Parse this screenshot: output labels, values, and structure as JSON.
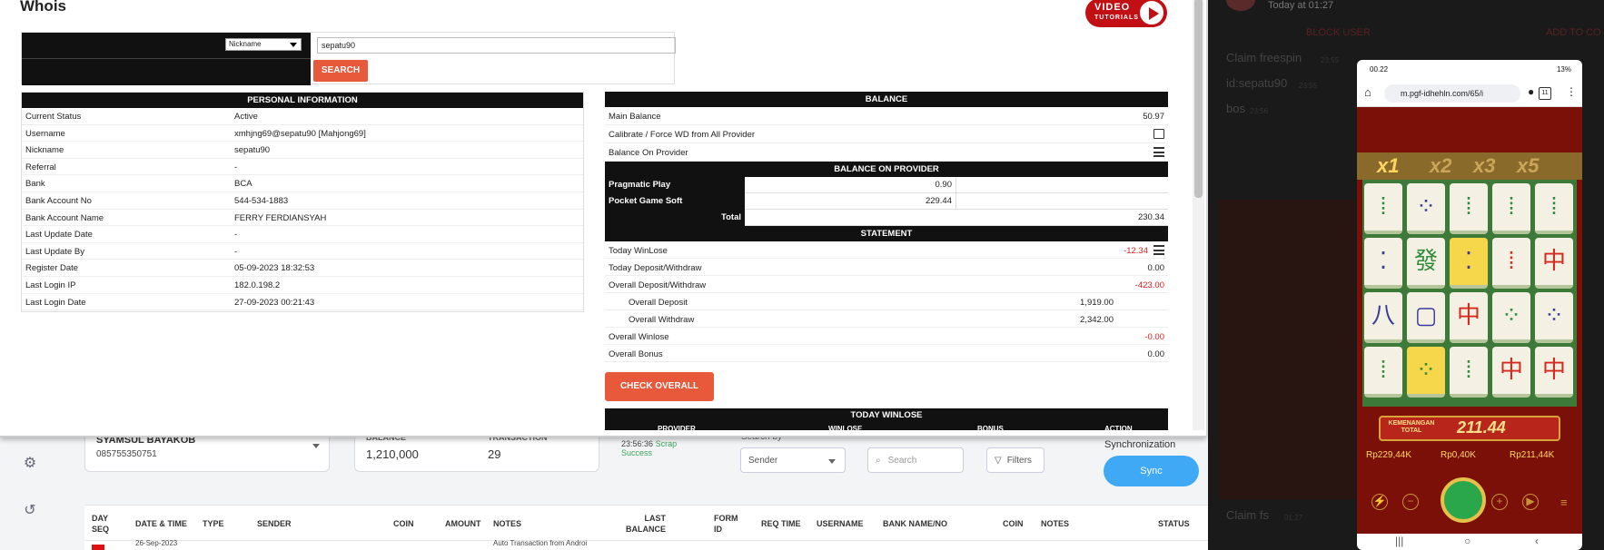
{
  "modal": {
    "title": "Whois",
    "video_line1": "VIDEO",
    "video_line2": "TUTORIALS"
  },
  "search": {
    "select_value": "Nickname",
    "input_value": "sepatu90",
    "button_label": "SEARCH"
  },
  "personal": {
    "header": "PERSONAL INFORMATION",
    "rows": [
      {
        "label": "Current Status",
        "value": "Active"
      },
      {
        "label": "Username",
        "value": "xmhjng69@sepatu90  [Mahjong69]"
      },
      {
        "label": "Nickname",
        "value": "sepatu90"
      },
      {
        "label": "Referral",
        "value": "-"
      },
      {
        "label": "Bank",
        "value": "BCA"
      },
      {
        "label": "Bank Account No",
        "value": "544-534-1883"
      },
      {
        "label": "Bank Account Name",
        "value": "FERRY FERDIANSYAH"
      },
      {
        "label": "Last Update Date",
        "value": "-"
      },
      {
        "label": "Last Update By",
        "value": "-"
      },
      {
        "label": "Register Date",
        "value": "05-09-2023 18:32:53"
      },
      {
        "label": "Last Login IP",
        "value": "182.0.198.2"
      },
      {
        "label": "Last Login Date",
        "value": "27-09-2023 00:21:43"
      }
    ]
  },
  "balance": {
    "header": "BALANCE",
    "main_label": "Main Balance",
    "main_value": "50.97",
    "calibrate_label": "Calibrate / Force WD from All Provider",
    "bop_label": "Balance On Provider",
    "provider_header": "BALANCE ON PROVIDER",
    "providers": [
      {
        "name": "Pragmatic Play",
        "value": "0.90"
      },
      {
        "name": "Pocket Game Soft",
        "value": "229.44"
      }
    ],
    "total_label": "Total",
    "total_value": "230.34"
  },
  "statement": {
    "header": "STATEMENT",
    "today_winlose_label": "Today WinLose",
    "today_winlose_value": "-12.34",
    "today_dw_label": "Today Deposit/Withdraw",
    "today_dw_value": "0.00",
    "overall_dw_label": "Overall Deposit/Withdraw",
    "overall_dw_value": "-423.00",
    "overall_deposit_label": "Overall Deposit",
    "overall_deposit_value": "1,919.00",
    "overall_withdraw_label": "Overall Withdraw",
    "overall_withdraw_value": "2,342.00",
    "overall_winlose_label": "Overall Winlose",
    "overall_winlose_value": "-0.00",
    "overall_bonus_label": "Overall Bonus",
    "overall_bonus_value": "0.00",
    "check_button": "CHECK OVERALL",
    "today_winlose_header": "TODAY WINLOSE",
    "today_winlose_cols": [
      "PROVIDER",
      "WINLOSE",
      "BONUS",
      "ACTION"
    ]
  },
  "background": {
    "customer_name": "SYAMSUL BAYAKOB",
    "customer_phone": "085755350751",
    "balance_label": "BALANCE",
    "balance_value": "1,210,000",
    "transaction_label": "TRANSACTION",
    "transaction_value": "29",
    "scrap_time": "23:56:36",
    "scrap_word": "Scrap",
    "scrap_status": "Success",
    "search_by_label": "Search by",
    "sender_select": "Sender",
    "search_placeholder": "Search",
    "filters_label": "Filters",
    "sync_title": "Synchronization",
    "sync_button": "Sync",
    "columns": [
      "DAY SEQ",
      "DATE & TIME",
      "TYPE",
      "SENDER",
      "COIN",
      "AMOUNT",
      "NOTES",
      "LAST BALANCE",
      "FORM ID",
      "REQ TIME",
      "USERNAME",
      "BANK NAME/NO",
      "COIN",
      "NOTES",
      "STATUS"
    ],
    "row_date": "26-Sep-2023",
    "row_note": "Auto Transaction from Androi"
  },
  "chat": {
    "time": "Today at 01:27",
    "block_user": "BLOCK USER",
    "add_to": "ADD TO CO",
    "msg1": "Claim freespin",
    "msg1_time": "23:55",
    "msg2": "id:sepatu90",
    "msg2_time": "23:55",
    "msg3": "bos",
    "msg3_time": "23:56",
    "msg4": "Claim fs",
    "msg4_time": "01:27"
  },
  "phone": {
    "clock": "00.22",
    "battery": "13%",
    "url": "m.pgf-idhehln.com/65/i",
    "tab_count": "11",
    "multipliers": [
      "x1",
      "x2",
      "x3",
      "x5"
    ],
    "win_label": "KEMENANGAN TOTAL",
    "win_amount": "211.44",
    "stat1": "Rp229,44K",
    "stat2": "Rp0,40K",
    "stat3": "Rp211,44K"
  },
  "colors": {
    "accent_red": "#e8593c",
    "header_black": "#111111",
    "sync_blue": "#3fa9f5",
    "negative_red": "#dd2222"
  }
}
